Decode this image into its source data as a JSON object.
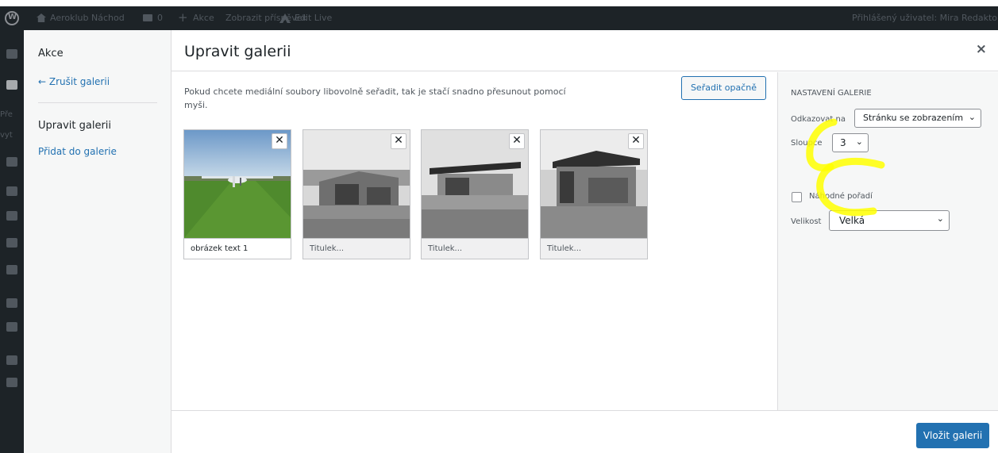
{
  "admin_bar": {
    "site_name": "Aeroklub Náchod",
    "comments_count": "0",
    "new_label": "Akce",
    "view_post": "Zobrazit příspěvek",
    "edit_live": "Edit Live",
    "user_text": "Přihlášený uživatel: Mira Redaktor"
  },
  "admin_sidebar": {
    "partial_text_1": "Pře",
    "partial_text_2": "vyt"
  },
  "modal": {
    "menu": {
      "title": "Akce",
      "cancel": "← Zrušit galerii",
      "edit": "Upravit galerii",
      "add": "Přidat do galerie"
    },
    "title": "Upravit galerii",
    "close_symbol": "×",
    "instructions": "Pokud chcete mediální soubory libovolně seřadit, tak je stačí snadno přesunout pomocí myši.",
    "reverse_button": "Seřadit opačně",
    "attachments": [
      {
        "caption": "obrázek text 1",
        "remove": "✕"
      },
      {
        "caption": "Titulek...",
        "remove": "✕"
      },
      {
        "caption": "Titulek...",
        "remove": "✕"
      },
      {
        "caption": "Titulek...",
        "remove": "✕"
      }
    ],
    "settings": {
      "heading": "NASTAVENÍ GALERIE",
      "link_label": "Odkazovat na",
      "link_value": "Stránku se zobrazením",
      "columns_label": "Sloupce",
      "columns_value": "3",
      "random_label": "Náhodné pořadí",
      "size_label": "Velikost",
      "size_value": "Velká",
      "chevron": "⌄"
    },
    "insert_button": "Vložit galerii"
  },
  "colors": {
    "accent": "#2271b1",
    "admin_bar": "#1d2327",
    "highlight": "#ffff00"
  }
}
